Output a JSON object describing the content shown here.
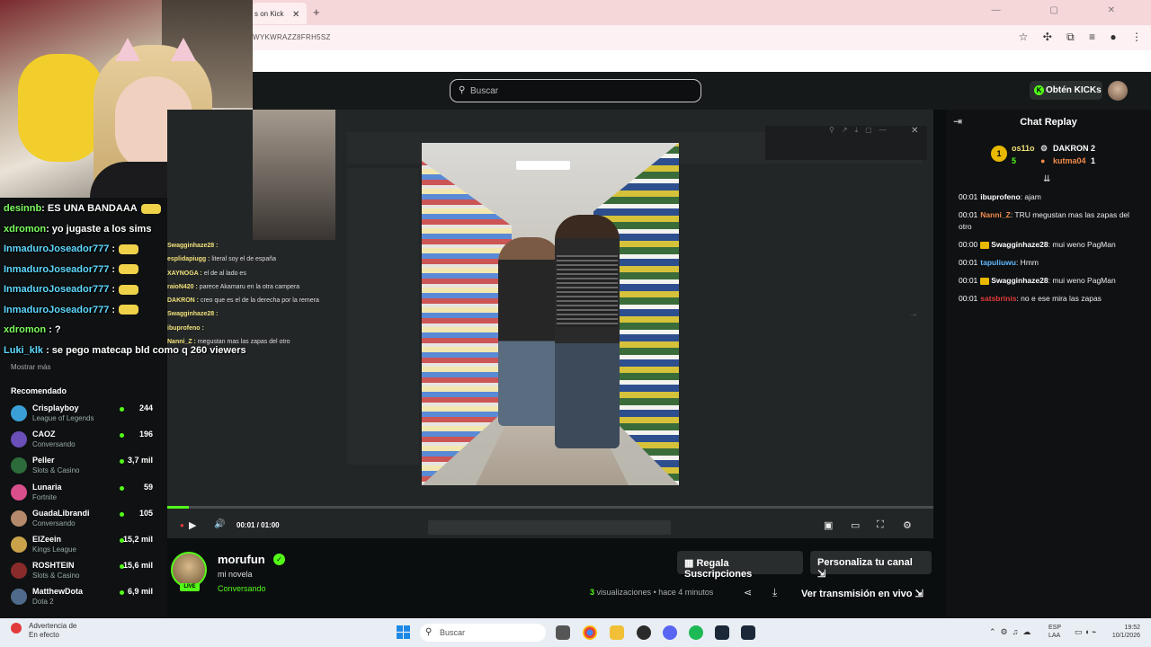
{
  "browser": {
    "tab_title": "s on Kick",
    "tab_close": "✕",
    "new_tab": "+",
    "url": "WYKWRAZZ8FRH5SZ",
    "window_controls": "— ▢ ✕"
  },
  "header": {
    "search_placeholder": "Buscar",
    "kicks_button": "Obtén KICKs"
  },
  "overlay_chat": [
    {
      "user": "desinnb",
      "text": ": ES UNA BANDAAA",
      "emote": true
    },
    {
      "user": "xdromon",
      "text": ": yo jugaste a los sims",
      "emote": false
    },
    {
      "user": "InmaduroJoseador777",
      "text": " :",
      "emote": true
    },
    {
      "user": "InmaduroJoseador777",
      "text": " :",
      "emote": true
    },
    {
      "user": "InmaduroJoseador777",
      "text": " :",
      "emote": true
    },
    {
      "user": "InmaduroJoseador777",
      "text": " :",
      "emote": true
    },
    {
      "user": "xdromon",
      "text": " : ?",
      "emote": false
    },
    {
      "user": "Luki_klk",
      "text": " : se pego matecap bld como q 260 viewers",
      "emote": false
    }
  ],
  "sidebar": {
    "show_more": "Mostrar más",
    "recommended_title": "Recomendado",
    "recommended": [
      {
        "name": "Crisplayboy",
        "category": "League of Legends",
        "viewers": "244",
        "color": "#3a9fd6"
      },
      {
        "name": "CAOZ",
        "category": "Conversando",
        "viewers": "196",
        "color": "#6a4fb8"
      },
      {
        "name": "Peller",
        "category": "Slots & Casino",
        "viewers": "3,7 mil",
        "color": "#2d6b3a"
      },
      {
        "name": "Lunaria",
        "category": "Fortnite",
        "viewers": "59",
        "color": "#d94f8c"
      },
      {
        "name": "GuadaLibrandi",
        "category": "Conversando",
        "viewers": "105",
        "color": "#b58a6c"
      },
      {
        "name": "ElZeein",
        "category": "Kings League",
        "viewers": "15,2 mil",
        "color": "#c9a24a"
      },
      {
        "name": "ROSHTEIN",
        "category": "Slots & Casino",
        "viewers": "15,6 mil",
        "color": "#8a2b2b"
      },
      {
        "name": "MatthewDota",
        "category": "Dota 2",
        "viewers": "6,9 mil",
        "color": "#4f6a8a"
      }
    ]
  },
  "mirror_chat": [
    {
      "user": "Swagginhaze28 :",
      "text": ""
    },
    {
      "user": "esplidapiugg :",
      "text": " literal soy el de españa"
    },
    {
      "user": "XAYNOGA :",
      "text": " el de al lado es"
    },
    {
      "user": "raioN420 :",
      "text": " parece Akamaru en la otra campera"
    },
    {
      "user": "DAKRON :",
      "text": " creo que es el de la derecha por la remera"
    },
    {
      "user": "Swagginhaze28 :",
      "text": ""
    },
    {
      "user": "ibuprofeno :",
      "text": ""
    },
    {
      "user": "Nanni_Z :",
      "text": " megustan mas las zapas del otro"
    }
  ],
  "player": {
    "time": "00:01 / 01:00",
    "progress": 0.028,
    "play_icon": "▶",
    "volume_icon": "🔊"
  },
  "chat_replay": {
    "title": "Chat Replay",
    "leaderboard": [
      {
        "rank": "1",
        "name": "os11o",
        "count": "5"
      },
      {
        "name": "DAKRON",
        "count": "2"
      },
      {
        "name": "kutma04",
        "count": "1"
      }
    ],
    "messages": [
      {
        "time": "00:01",
        "user": "ibuprofeno",
        "text": ": ajam",
        "color": "#ffffff",
        "crown": false
      },
      {
        "time": "00:01",
        "user": "Nanni_Z",
        "text": ": TRU megustan mas las zapas del otro",
        "color": "#f08a4b",
        "crown": false
      },
      {
        "time": "00:00",
        "user": "Swagginhaze28",
        "text": ": mui weno PagMan",
        "color": "#ffffff",
        "crown": true
      },
      {
        "time": "00:01",
        "user": "tapuliuwu",
        "text": ": Hmm",
        "color": "#5fb8ff",
        "crown": false
      },
      {
        "time": "00:01",
        "user": "Swagginhaze28",
        "text": ": mui weno PagMan",
        "color": "#ffffff",
        "crown": true
      },
      {
        "time": "00:01",
        "user": "satsbrinis",
        "text": ": no e ese mira las zapas",
        "color": "#e23b3b",
        "crown": false
      }
    ]
  },
  "stream": {
    "channel": "morufun",
    "live": "LIVE",
    "title": "mi novela",
    "category": "Conversando",
    "gift_button": "Regala Suscripciones",
    "customize_button": "Personaliza tu canal",
    "views_count": "3",
    "views_label": "visualizaciones",
    "ago": "• hace 4 minutos",
    "vertical_button": "Ver transmisión en vivo"
  },
  "taskbar": {
    "warning_line1": "Advertencia de",
    "warning_line2": "En efecto",
    "search": "Buscar",
    "lang_line1": "ESP",
    "lang_line2": "LAA",
    "time": "19:52",
    "date": "10/1/2026"
  },
  "colors": {
    "accent": "#53fc18"
  }
}
